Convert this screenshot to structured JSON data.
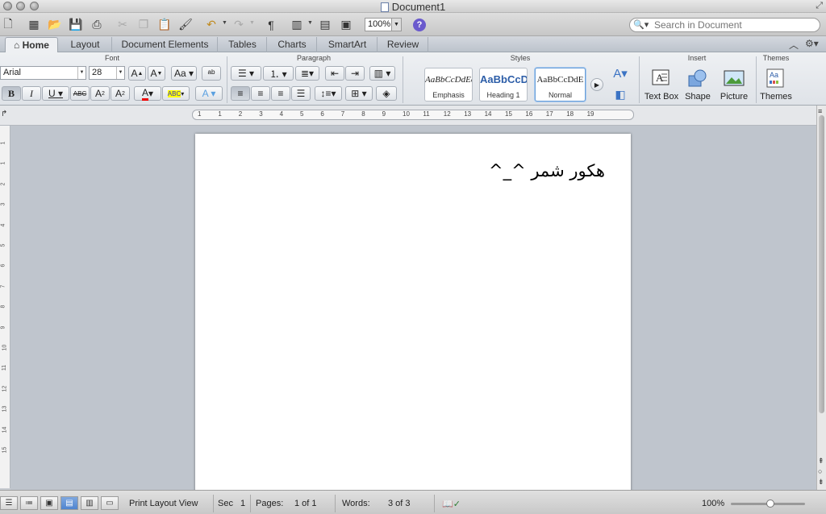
{
  "window": {
    "title": "Document1"
  },
  "toolbar": {
    "zoom_value": "100%",
    "search_placeholder": "Search in Document"
  },
  "tabs": [
    {
      "label": "Home"
    },
    {
      "label": "Layout"
    },
    {
      "label": "Document Elements"
    },
    {
      "label": "Tables"
    },
    {
      "label": "Charts"
    },
    {
      "label": "SmartArt"
    },
    {
      "label": "Review"
    }
  ],
  "ribbon": {
    "groups": {
      "font": "Font",
      "paragraph": "Paragraph",
      "styles": "Styles",
      "insert": "Insert",
      "themes": "Themes"
    },
    "font_name": "Arial",
    "font_size": "28",
    "styles": [
      {
        "sample": "AaBbCcDdEe",
        "name": "Emphasis"
      },
      {
        "sample": "AaBbCcDc",
        "name": "Heading 1"
      },
      {
        "sample": "AaBbCcDdE",
        "name": "Normal"
      }
    ],
    "insert_items": [
      {
        "label": "Text Box"
      },
      {
        "label": "Shape"
      },
      {
        "label": "Picture"
      }
    ],
    "themes_label": "Themes"
  },
  "ruler": {
    "numbers": [
      "1",
      "1",
      "2",
      "3",
      "4",
      "5",
      "6",
      "7",
      "8",
      "9",
      "10",
      "11",
      "12",
      "13",
      "14",
      "15",
      "16",
      "17",
      "18",
      "19"
    ]
  },
  "vruler": {
    "numbers": [
      "1",
      "1",
      "2",
      "3",
      "4",
      "5",
      "6",
      "7",
      "8",
      "9",
      "10",
      "11",
      "12",
      "13",
      "14",
      "15"
    ]
  },
  "document": {
    "text": "هكور شمر ^_^"
  },
  "status": {
    "view": "Print Layout View",
    "sec_label": "Sec",
    "sec_value": "1",
    "pages_label": "Pages:",
    "pages_value": "1 of 1",
    "words_label": "Words:",
    "words_value": "3 of 3",
    "zoom": "100%"
  }
}
